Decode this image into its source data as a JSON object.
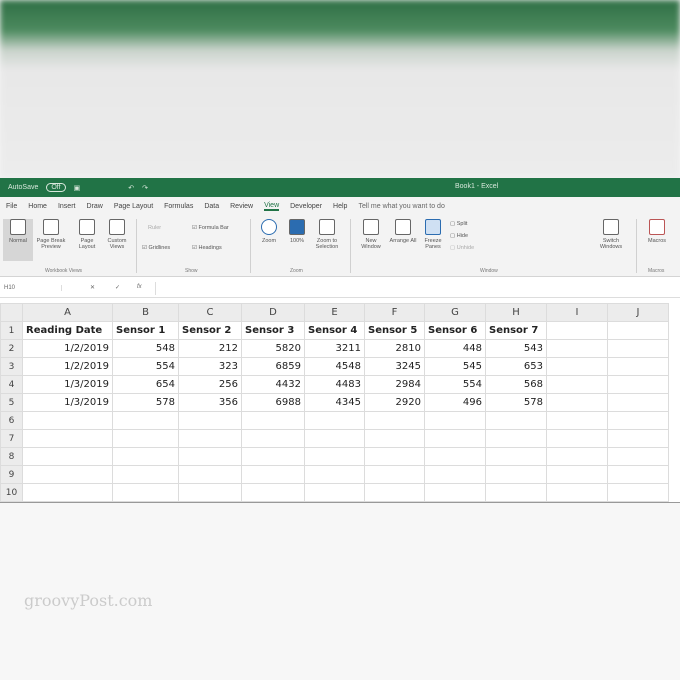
{
  "titlebar": {
    "autosave": "AutoSave",
    "autosave_state": "Off",
    "title": "Book1 - Excel"
  },
  "tabs": [
    "File",
    "Home",
    "Insert",
    "Draw",
    "Page Layout",
    "Formulas",
    "Data",
    "Review",
    "View",
    "Developer",
    "Help",
    "Tell me what you want to do"
  ],
  "active_tab": "View",
  "ribbon": {
    "buttons": [
      {
        "label": "Normal"
      },
      {
        "label": "Page Break Preview"
      },
      {
        "label": "Page Layout"
      },
      {
        "label": "Custom Views"
      },
      {
        "label": "Zoom"
      },
      {
        "label": "100%"
      },
      {
        "label": "Zoom to Selection"
      },
      {
        "label": "New Window"
      },
      {
        "label": "Arrange All"
      },
      {
        "label": "Freeze Panes"
      },
      {
        "label": "Switch Windows"
      },
      {
        "label": "Macros"
      }
    ],
    "show": {
      "ruler": "Ruler",
      "formula_bar": "Formula Bar",
      "gridlines": "Gridlines",
      "headings": "Headings"
    },
    "window_small": {
      "split": "Split",
      "hide": "Hide",
      "unhide": "Unhide"
    },
    "groups": {
      "views": "Workbook Views",
      "show": "Show",
      "zoom": "Zoom",
      "window": "Window",
      "macros": "Macros"
    }
  },
  "formula_bar": {
    "name_box": "H10",
    "fx": "fx"
  },
  "columns": [
    "A",
    "B",
    "C",
    "D",
    "E",
    "F",
    "G",
    "H",
    "I",
    "J"
  ],
  "rows": [
    [
      "Reading Date",
      "Sensor 1",
      "Sensor 2",
      "Sensor 3",
      "Sensor 4",
      "Sensor 5",
      "Sensor 6",
      "Sensor 7"
    ],
    [
      "1/2/2019",
      "548",
      "212",
      "5820",
      "3211",
      "2810",
      "448",
      "543"
    ],
    [
      "1/2/2019",
      "554",
      "323",
      "6859",
      "4548",
      "3245",
      "545",
      "653"
    ],
    [
      "1/3/2019",
      "654",
      "256",
      "4432",
      "4483",
      "2984",
      "554",
      "568"
    ],
    [
      "1/3/2019",
      "578",
      "356",
      "6988",
      "4345",
      "2920",
      "496",
      "578"
    ]
  ],
  "row_count": 10,
  "watermark": "groovyPost.com"
}
